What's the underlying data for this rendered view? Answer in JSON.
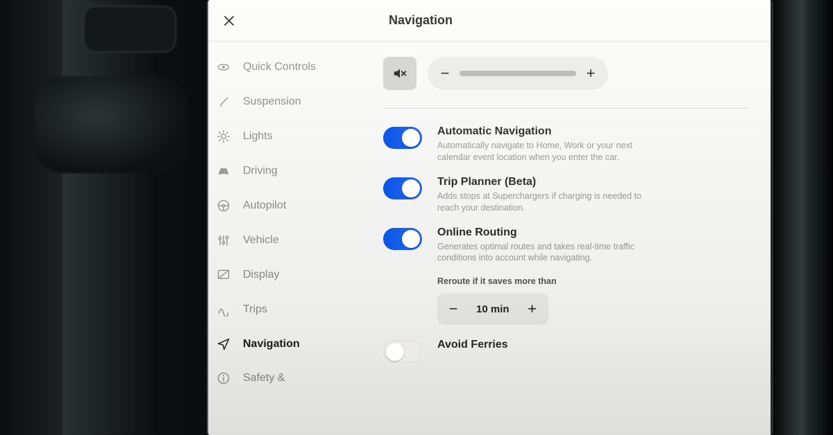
{
  "header": {
    "title": "Navigation"
  },
  "sidebar": {
    "items": [
      {
        "id": "quick-controls",
        "label": "Quick Controls"
      },
      {
        "id": "suspension",
        "label": "Suspension"
      },
      {
        "id": "lights",
        "label": "Lights"
      },
      {
        "id": "driving",
        "label": "Driving"
      },
      {
        "id": "autopilot",
        "label": "Autopilot"
      },
      {
        "id": "vehicle",
        "label": "Vehicle"
      },
      {
        "id": "display",
        "label": "Display"
      },
      {
        "id": "trips",
        "label": "Trips"
      },
      {
        "id": "navigation",
        "label": "Navigation"
      },
      {
        "id": "safety",
        "label": "Safety &"
      }
    ],
    "active_index": 8
  },
  "main": {
    "volume": {
      "muted": true
    },
    "options": [
      {
        "id": "automatic-navigation",
        "title": "Automatic Navigation",
        "desc": "Automatically navigate to Home, Work or your next calendar event location when you enter the car.",
        "on": true
      },
      {
        "id": "trip-planner",
        "title": "Trip Planner (Beta)",
        "desc": "Adds stops at Superchargers if charging is needed to reach your destination.",
        "on": true
      },
      {
        "id": "online-routing",
        "title": "Online Routing",
        "desc": "Generates optimal routes and takes real-time traffic conditions into account while navigating.",
        "on": true
      }
    ],
    "reroute": {
      "label": "Reroute if it saves more than",
      "value": "10 min"
    },
    "avoid_ferries": {
      "title": "Avoid Ferries",
      "on": false
    }
  }
}
